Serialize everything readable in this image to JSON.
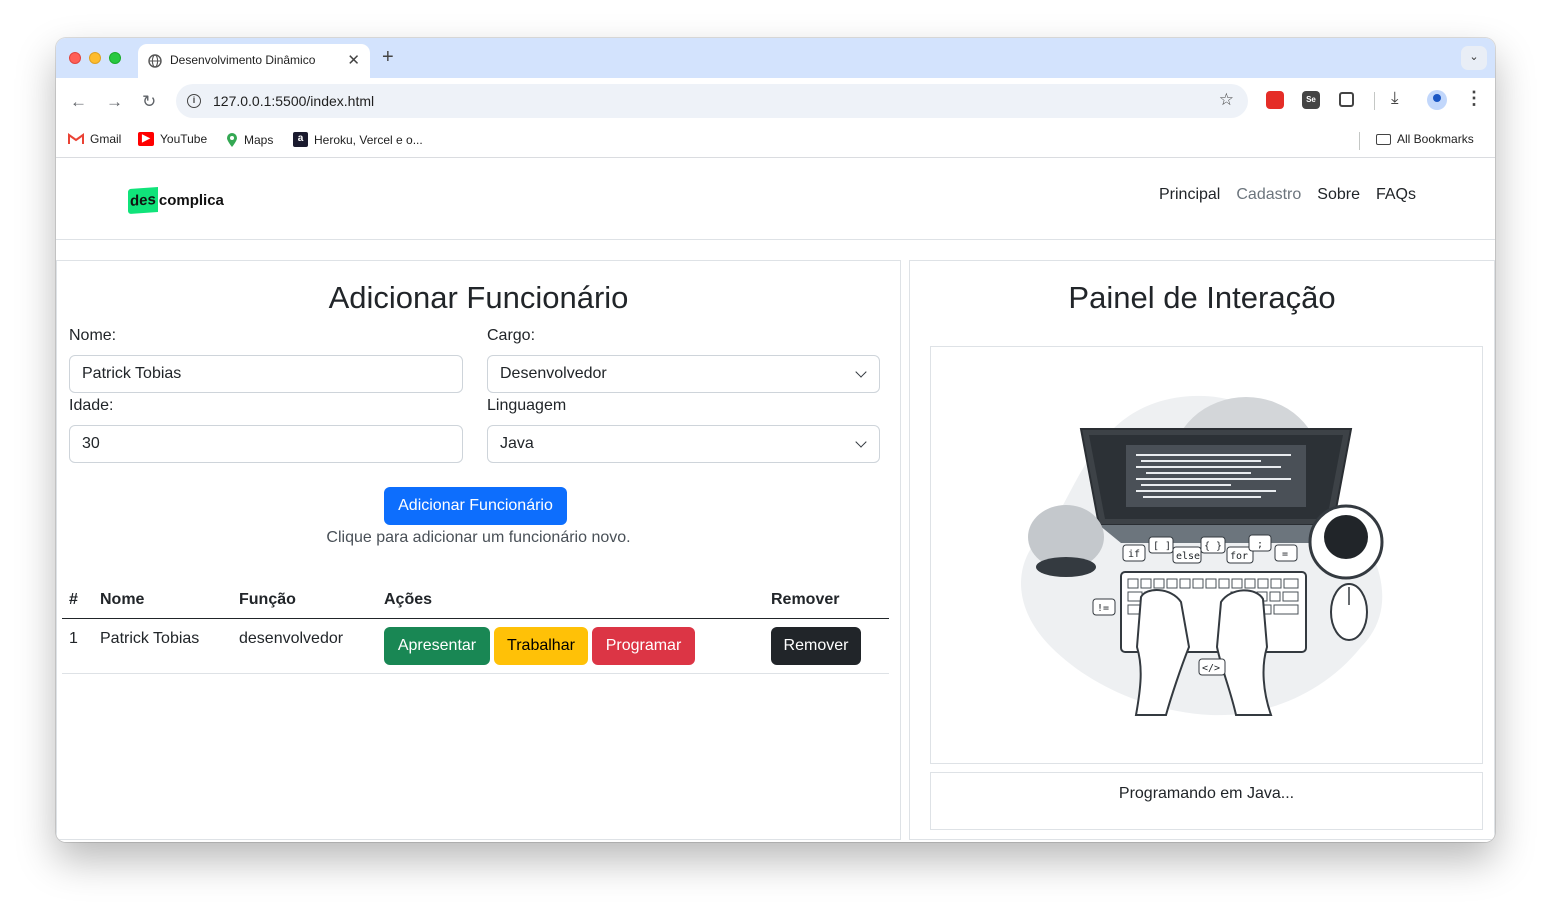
{
  "browser": {
    "tab_title": "Desenvolvimento Dinâmico",
    "tab_close": "✕",
    "new_tab": "+",
    "url": "127.0.0.1:5500/index.html",
    "bookmarks": [
      {
        "label": "Gmail",
        "icon": "gmail-icon"
      },
      {
        "label": "YouTube",
        "icon": "youtube-icon"
      },
      {
        "label": "Maps",
        "icon": "maps-icon"
      },
      {
        "label": "Heroku, Vercel e o...",
        "icon": "heroku-icon"
      }
    ],
    "all_bookmarks": "All Bookmarks"
  },
  "nav": {
    "logo_left": "des",
    "logo_right": "complica",
    "links": [
      "Principal",
      "Cadastro",
      "Sobre",
      "FAQs"
    ]
  },
  "form": {
    "title": "Adicionar Funcionário",
    "name_label": "Nome:",
    "name_value": "Patrick Tobias",
    "cargo_label": "Cargo:",
    "cargo_value": "Desenvolvedor",
    "age_label": "Idade:",
    "age_value": "30",
    "lang_label": "Linguagem",
    "lang_value": "Java",
    "submit_label": "Adicionar Funcionário",
    "hint": "Clique para adicionar um funcionário novo."
  },
  "table": {
    "headers": [
      "#",
      "Nome",
      "Função",
      "Ações",
      "Remover"
    ],
    "rows": [
      {
        "id": "1",
        "name": "Patrick Tobias",
        "role": "desenvolvedor",
        "actions": [
          "Apresentar",
          "Trabalhar",
          "Programar"
        ],
        "remove": "Remover"
      }
    ]
  },
  "panel": {
    "title": "Painel de Interação",
    "illustration_labels": [
      "if",
      "[ ]",
      "else",
      "{ }",
      "for",
      ";",
      "=",
      "!=",
      "</>"
    ],
    "status": "Programando em Java..."
  }
}
